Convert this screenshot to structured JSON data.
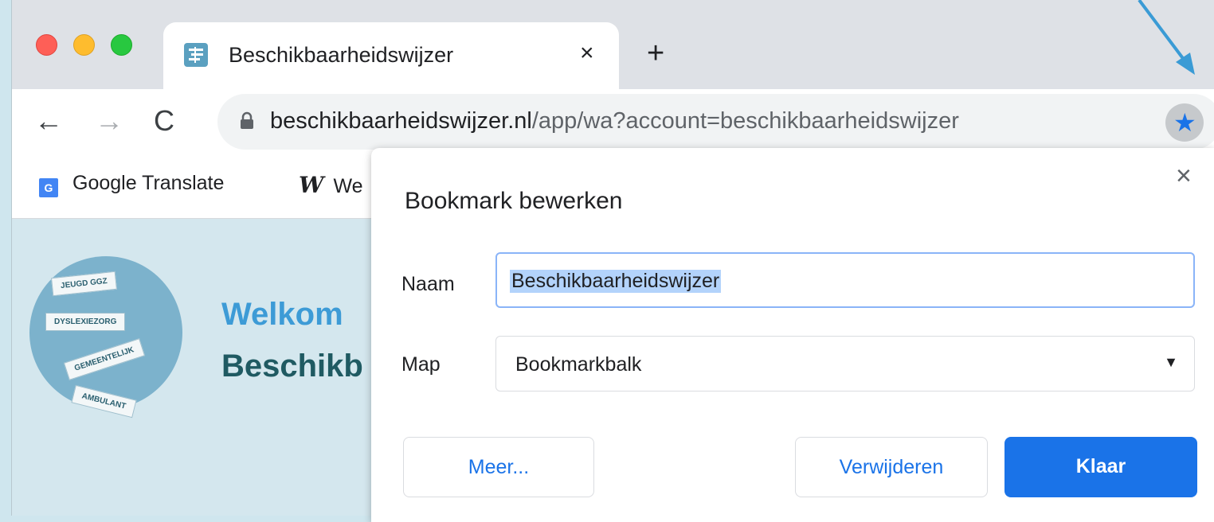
{
  "tab": {
    "title": "Beschikbaarheidswijzer",
    "close_glyph": "×",
    "new_tab_glyph": "+"
  },
  "toolbar": {
    "back_glyph": "←",
    "forward_glyph": "→",
    "reload_glyph": "C",
    "url_host": "beschikbaarheidswijzer.nl",
    "url_path": "/app/wa?account=beschikbaarheidswijzer",
    "bookmark_star_glyph": "★"
  },
  "bookmarks_bar": {
    "items": [
      {
        "label": "Google Translate",
        "icon": "google-translate-icon"
      },
      {
        "label": "We",
        "icon": "w-icon"
      }
    ]
  },
  "page": {
    "welcome_line1": "Welkom",
    "welcome_line2": "Beschikb",
    "signs": [
      "JEUGD GGZ",
      "DYSLEXIEZORG",
      "GEMEENTELIJK",
      "AMBULANT"
    ]
  },
  "dialog": {
    "title": "Bookmark bewerken",
    "close_glyph": "×",
    "name_label": "Naam",
    "name_value": "Beschikbaarheidswijzer",
    "map_label": "Map",
    "map_value": "Bookmarkbalk",
    "more_button": "Meer...",
    "remove_button": "Verwijderen",
    "done_button": "Klaar"
  },
  "colors": {
    "accent": "#1a73e8",
    "background": "#cfe6ee",
    "welcome_blue": "#3d9bd6",
    "welcome_teal": "#1f5a62"
  }
}
